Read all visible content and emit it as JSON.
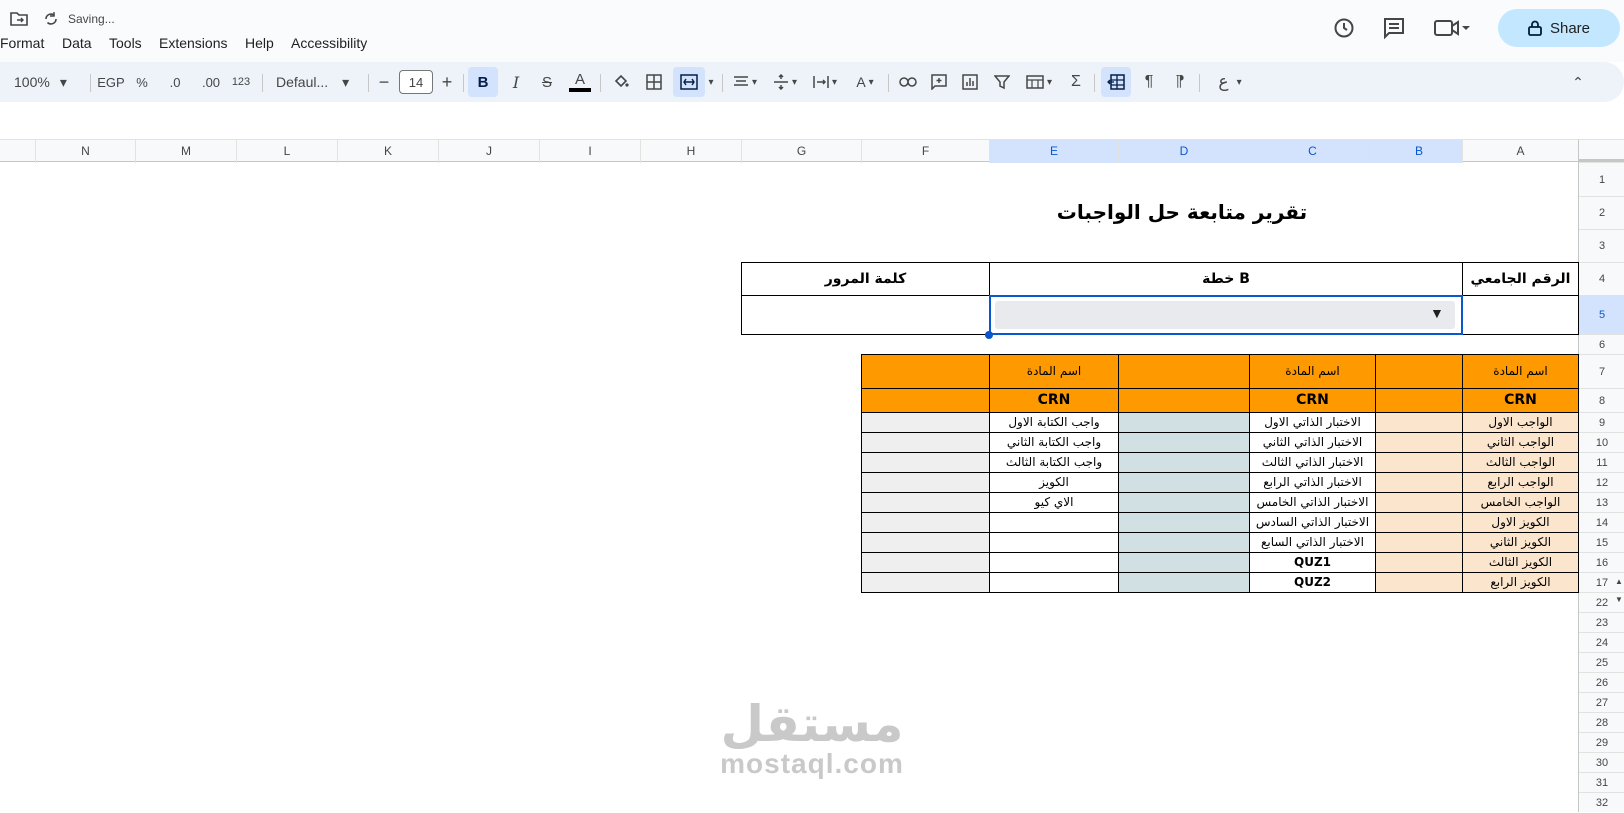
{
  "topbar": {
    "status": "Saving...",
    "menu": [
      "Format",
      "Data",
      "Tools",
      "Extensions",
      "Help",
      "Accessibility"
    ],
    "share_label": "Share",
    "icons": [
      "move-to-folder-icon",
      "sync-icon",
      "history-icon",
      "comments-icon",
      "video-call-icon",
      "lock-icon"
    ]
  },
  "toolbar": {
    "zoom": "100%",
    "currency": "EGP",
    "percent": "%",
    "dec_decrease": ".0",
    "dec_increase": ".00",
    "number_format": "123",
    "font": "Defaul...",
    "font_size": "14"
  },
  "columns": [
    "N",
    "M",
    "L",
    "K",
    "J",
    "I",
    "H",
    "G",
    "F",
    "E",
    "D",
    "C",
    "B",
    "A"
  ],
  "rows": [
    "1",
    "2",
    "3",
    "4",
    "5",
    "6",
    "7",
    "8",
    "9",
    "10",
    "11",
    "12",
    "13",
    "14",
    "15",
    "16",
    "17",
    "22",
    "23",
    "24",
    "25",
    "26",
    "27",
    "28",
    "29",
    "30",
    "31",
    "32"
  ],
  "sheet": {
    "title": "تقرير متابعة حل الواجبات",
    "student_id_label": "الرقم الجامعي",
    "plan_label": "خطة B",
    "password_label": "كلمة المرور",
    "subject_label": "اسم المادة",
    "crn_label": "CRN",
    "col_a": [
      "الواجب الاول",
      "الواجب الثاني",
      "الواجب الثالث",
      "الواجب الرابع",
      "الواجب الخامس",
      "الكويز الاول",
      "الكويز الثاني",
      "الكويز الثالث",
      "الكويز الرابع"
    ],
    "col_c": [
      "الاختبار الذاتي الاول",
      "الاختبار الذاتي الثاني",
      "الاختبار الذاتي الثالث",
      "الاختبار الذاتي الرابع",
      "الاختبار الذاتي الخامس",
      "الاختبار الذاتي السادس",
      "الاختبار الذاتي السابع",
      "QUZ1",
      "QUZ2"
    ],
    "col_e": [
      "واجب الكتابة الاول",
      "واجب الكتابة الثاني",
      "واجب الكتابة الثالث",
      "الكويز",
      "الاي كيو",
      "",
      "",
      "",
      ""
    ]
  },
  "watermark": {
    "arabic": "مستقل",
    "latin": "mostaql.com"
  },
  "colors": {
    "orange": "#ff9900",
    "peach": "#fce5cd",
    "teal": "#d0e0e3",
    "grey": "#efefef",
    "share_bg": "#c2e7ff",
    "selection": "#0b57d0"
  }
}
